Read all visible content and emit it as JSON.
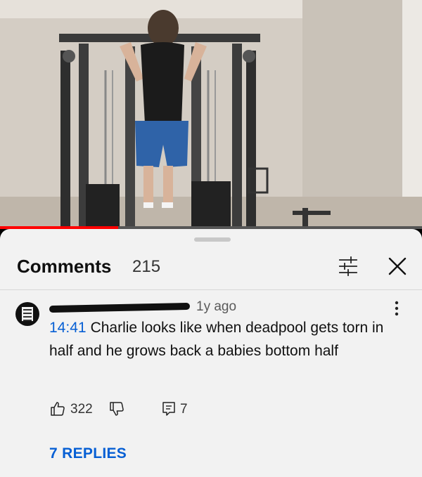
{
  "video": {
    "progress_fraction": 0.28
  },
  "comments": {
    "title": "Comments",
    "count": "215"
  },
  "comment": {
    "age": "1y ago",
    "timestamp": "14:41",
    "text": "Charlie looks like when deadpool gets torn in half and he grows back a babies bottom half",
    "like_count": "322",
    "reply_count": "7",
    "replies_label": "7 REPLIES"
  },
  "colors": {
    "link_blue": "#065fd4",
    "progress_red": "#ff0000",
    "sheet_background": "#f2f2f2"
  },
  "icons": {
    "filter": "filter-icon",
    "close": "close-icon",
    "more": "more-vertical-icon",
    "like": "thumb-up-icon",
    "dislike": "thumb-down-icon",
    "reply": "reply-icon"
  }
}
